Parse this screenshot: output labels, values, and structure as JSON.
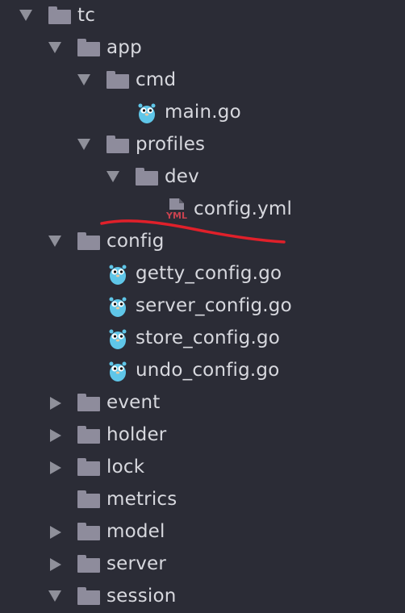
{
  "tree": {
    "items": [
      {
        "label": "tc",
        "type": "folder",
        "state": "open",
        "icon": "folder-icon"
      },
      {
        "label": "app",
        "type": "folder",
        "state": "open",
        "icon": "folder-icon"
      },
      {
        "label": "cmd",
        "type": "folder",
        "state": "open",
        "icon": "folder-icon"
      },
      {
        "label": "main.go",
        "type": "file",
        "icon": "go-gopher-icon"
      },
      {
        "label": "profiles",
        "type": "folder",
        "state": "open",
        "icon": "folder-icon"
      },
      {
        "label": "dev",
        "type": "folder",
        "state": "open",
        "icon": "folder-icon"
      },
      {
        "label": "config.yml",
        "type": "file",
        "icon": "yml-file-icon",
        "badge": "YML"
      },
      {
        "label": "config",
        "type": "folder",
        "state": "open",
        "icon": "folder-icon"
      },
      {
        "label": "getty_config.go",
        "type": "file",
        "icon": "go-gopher-icon"
      },
      {
        "label": "server_config.go",
        "type": "file",
        "icon": "go-gopher-icon"
      },
      {
        "label": "store_config.go",
        "type": "file",
        "icon": "go-gopher-icon"
      },
      {
        "label": "undo_config.go",
        "type": "file",
        "icon": "go-gopher-icon"
      },
      {
        "label": "event",
        "type": "folder",
        "state": "closed",
        "icon": "folder-icon"
      },
      {
        "label": "holder",
        "type": "folder",
        "state": "closed",
        "icon": "folder-icon"
      },
      {
        "label": "lock",
        "type": "folder",
        "state": "closed",
        "icon": "folder-icon"
      },
      {
        "label": "metrics",
        "type": "folder",
        "state": "none",
        "icon": "folder-icon"
      },
      {
        "label": "model",
        "type": "folder",
        "state": "closed",
        "icon": "folder-icon"
      },
      {
        "label": "server",
        "type": "folder",
        "state": "closed",
        "icon": "folder-icon"
      },
      {
        "label": "session",
        "type": "folder",
        "state": "open",
        "icon": "folder-icon"
      }
    ]
  },
  "colors": {
    "background": "#2b2c36",
    "text": "#d7d8de",
    "folder": "#8e8c9c",
    "arrow": "#8f909a",
    "gopher": "#5fc6e8",
    "yml_badge": "#c9424f",
    "annotation": "#e0202a"
  }
}
